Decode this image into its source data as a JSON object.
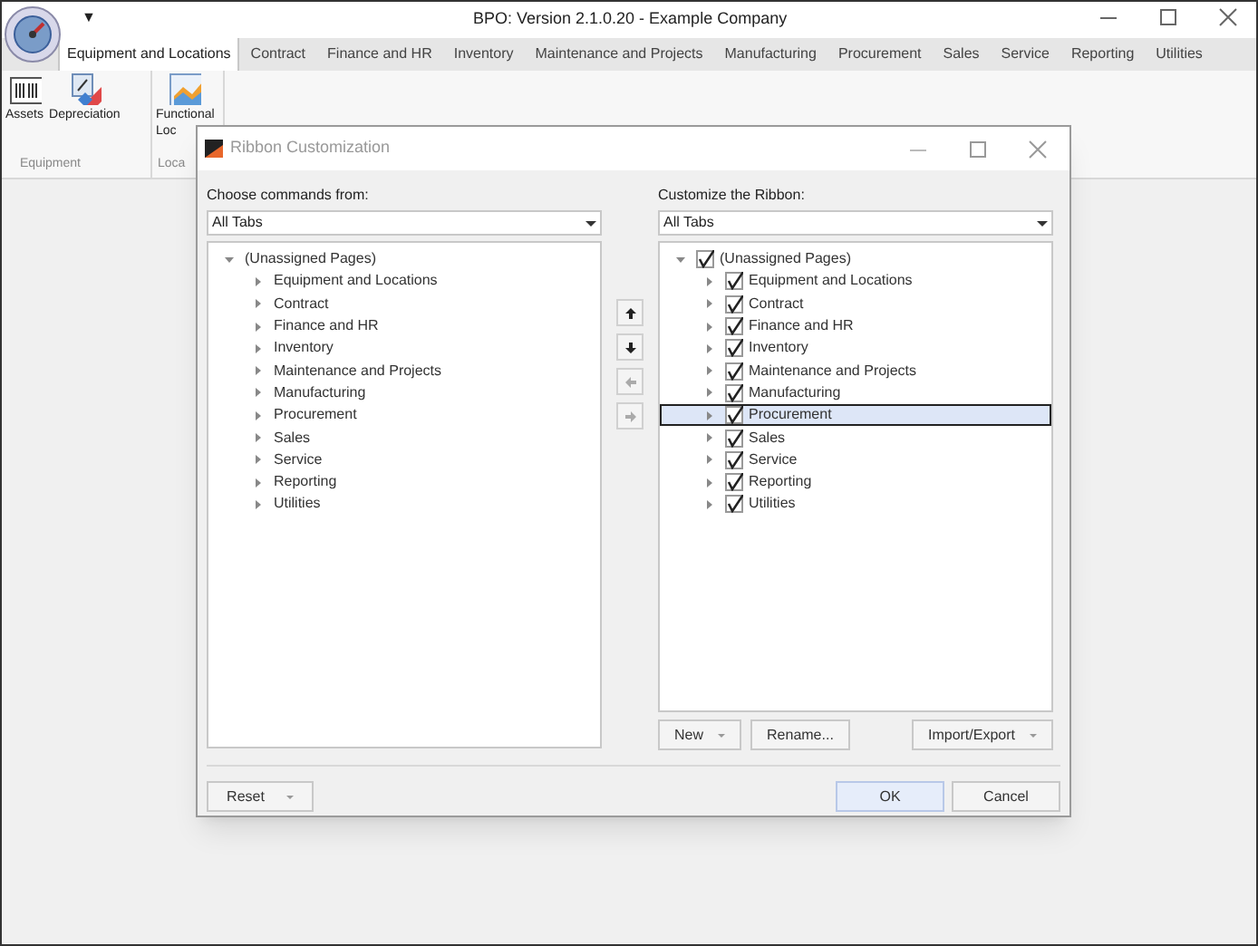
{
  "window": {
    "title": "BPO: Version 2.1.0.20 - Example Company",
    "quick_access": "▼"
  },
  "tabs": [
    {
      "label": "Equipment and Locations",
      "selected": true
    },
    {
      "label": "Contract",
      "selected": false
    },
    {
      "label": "Finance and HR",
      "selected": false
    },
    {
      "label": "Inventory",
      "selected": false
    },
    {
      "label": "Maintenance and Projects",
      "selected": false
    },
    {
      "label": "Manufacturing",
      "selected": false
    },
    {
      "label": "Procurement",
      "selected": false
    },
    {
      "label": "Sales",
      "selected": false
    },
    {
      "label": "Service",
      "selected": false
    },
    {
      "label": "Reporting",
      "selected": false
    },
    {
      "label": "Utilities",
      "selected": false
    }
  ],
  "ribbon_groups": [
    {
      "label": "Equipment",
      "items": [
        {
          "kind": "barcode",
          "label": "Assets"
        },
        {
          "kind": "percent",
          "label": "Depreciation"
        }
      ]
    },
    {
      "label": "Loca",
      "items": [
        {
          "kind": "chart",
          "label": "Functional",
          "label_2": "Loc"
        }
      ]
    }
  ],
  "dialog": {
    "title": "Ribbon Customization",
    "left": {
      "label": "Choose commands from:",
      "combo": "All Tabs",
      "tree": [
        {
          "label": "(Unassigned Pages)",
          "expanded": true,
          "children": [
            {
              "label": "Equipment and Locations",
              "expanded": false
            },
            {
              "label": "Contract",
              "expanded": false
            },
            {
              "label": "Finance and HR",
              "expanded": false
            },
            {
              "label": "Inventory",
              "expanded": false
            },
            {
              "label": "Maintenance and Projects",
              "expanded": false
            },
            {
              "label": "Manufacturing",
              "expanded": false
            },
            {
              "label": "Procurement",
              "expanded": false
            },
            {
              "label": "Sales",
              "expanded": false
            },
            {
              "label": "Service",
              "expanded": false
            },
            {
              "label": "Reporting",
              "expanded": false
            },
            {
              "label": "Utilities",
              "expanded": false
            }
          ]
        }
      ]
    },
    "move_buttons": [
      {
        "kind": "up",
        "disabled": false
      },
      {
        "kind": "down",
        "disabled": false
      },
      {
        "kind": "left",
        "disabled": true
      },
      {
        "kind": "right",
        "disabled": true
      }
    ],
    "right": {
      "label": "Customize the Ribbon:",
      "combo": "All Tabs",
      "tree": [
        {
          "label": "(Unassigned Pages)",
          "expanded": true,
          "checked": true,
          "selected": false,
          "children": [
            {
              "label": "Equipment and Locations",
              "expanded": false,
              "checked": true,
              "selected": false
            },
            {
              "label": "Contract",
              "expanded": false,
              "checked": true,
              "selected": false
            },
            {
              "label": "Finance and HR",
              "expanded": false,
              "checked": true,
              "selected": false
            },
            {
              "label": "Inventory",
              "expanded": false,
              "checked": true,
              "selected": false
            },
            {
              "label": "Maintenance and Projects",
              "expanded": false,
              "checked": true,
              "selected": false
            },
            {
              "label": "Manufacturing",
              "expanded": false,
              "checked": true,
              "selected": false
            },
            {
              "label": "Procurement",
              "expanded": false,
              "checked": true,
              "selected": true
            },
            {
              "label": "Sales",
              "expanded": false,
              "checked": true,
              "selected": false
            },
            {
              "label": "Service",
              "expanded": false,
              "checked": true,
              "selected": false
            },
            {
              "label": "Reporting",
              "expanded": false,
              "checked": true,
              "selected": false
            },
            {
              "label": "Utilities",
              "expanded": false,
              "checked": true,
              "selected": false
            }
          ]
        }
      ]
    },
    "tree_buttons": [
      {
        "label": "New",
        "dropdown": true
      },
      {
        "label": "Rename...",
        "dropdown": false
      },
      {
        "label": "Import/Export",
        "dropdown": true
      }
    ],
    "reset": {
      "label": "Reset",
      "dropdown": true
    },
    "footer_buttons": [
      {
        "label": "OK",
        "kind": "primary"
      },
      {
        "label": "Cancel",
        "kind": "normal"
      }
    ]
  }
}
